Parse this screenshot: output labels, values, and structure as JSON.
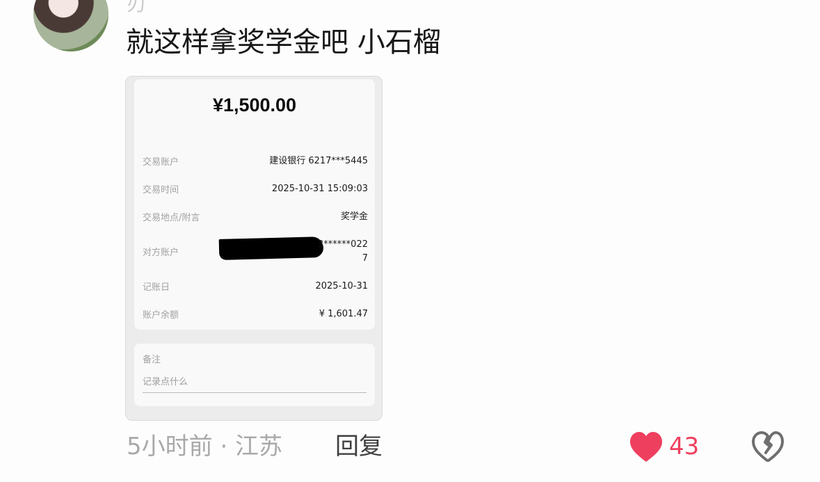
{
  "comment": {
    "username_fragment": "刃",
    "text": "就这样拿奖学金吧 小石榴",
    "meta": "5小时前 · 江苏",
    "reply_label": "回复",
    "likes": "43",
    "like_color": "#ef3f5f"
  },
  "receipt": {
    "amount": "¥1,500.00",
    "rows": [
      {
        "label": "交易账户",
        "value": "建设银行 6217***5445"
      },
      {
        "label": "交易时间",
        "value": "2025-10-31 15:09:03"
      },
      {
        "label": "交易地点/附言",
        "value": "奖学金"
      },
      {
        "label": "对方账户",
        "value": "3******022\n7"
      },
      {
        "label": "记账日",
        "value": "2025-10-31"
      },
      {
        "label": "账户余额",
        "value": "¥ 1,601.47"
      }
    ],
    "note_label": "备注",
    "note_placeholder": "记录点什么"
  },
  "icons": {
    "like": "heart-icon",
    "dislike": "broken-heart-icon"
  }
}
